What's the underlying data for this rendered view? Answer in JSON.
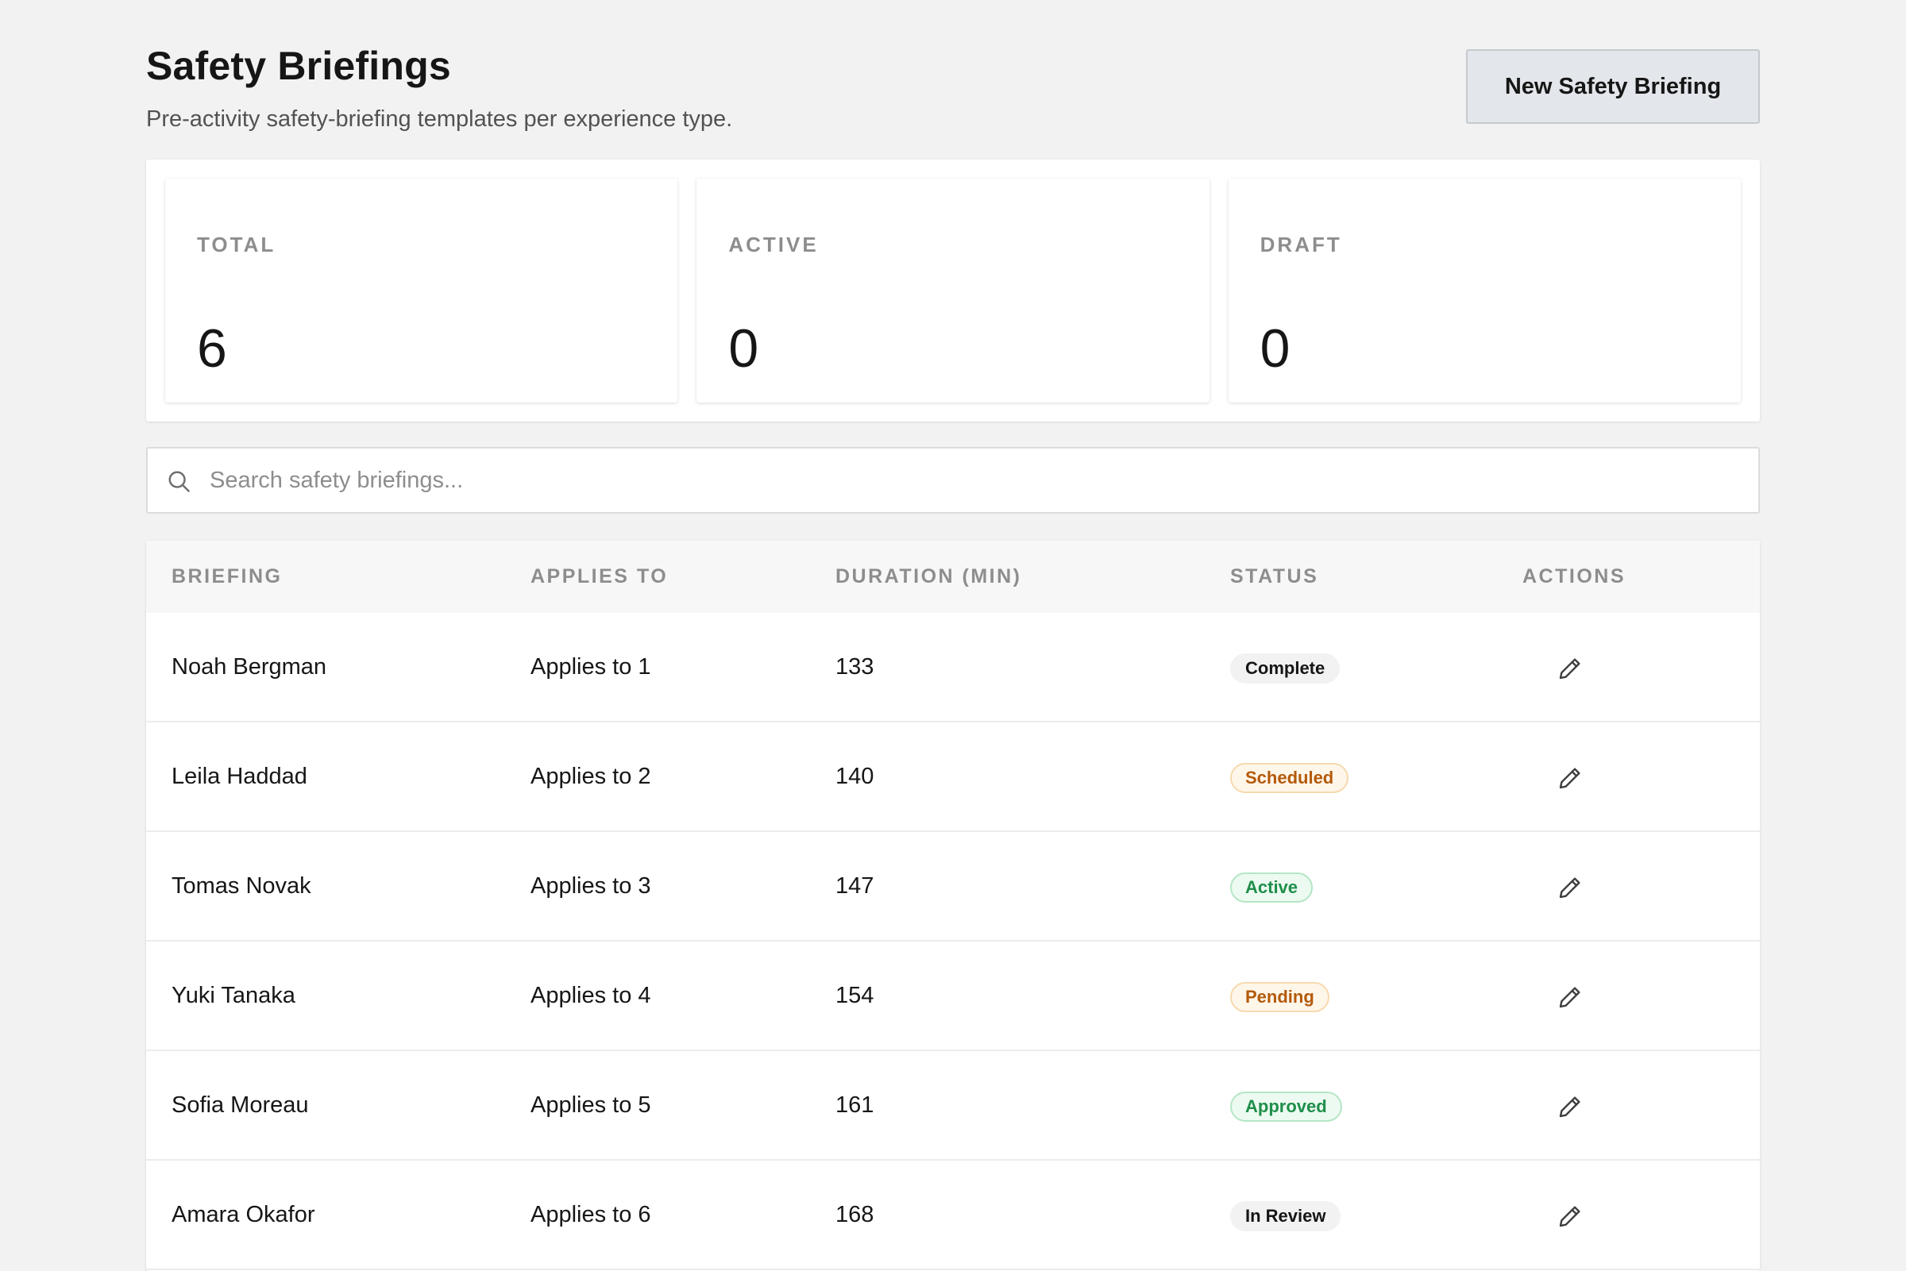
{
  "header": {
    "title": "Safety Briefings",
    "subtitle": "Pre-activity safety-briefing templates per experience type.",
    "new_button_label": "New Safety Briefing"
  },
  "stats": [
    {
      "label": "TOTAL",
      "value": "6"
    },
    {
      "label": "ACTIVE",
      "value": "0"
    },
    {
      "label": "DRAFT",
      "value": "0"
    }
  ],
  "search": {
    "placeholder": "Search safety briefings...",
    "value": ""
  },
  "table": {
    "columns": [
      "BRIEFING",
      "APPLIES TO",
      "DURATION (MIN)",
      "STATUS",
      "ACTIONS"
    ],
    "rows": [
      {
        "briefing": "Noah Bergman",
        "applies_to": "Applies to 1",
        "duration": "133",
        "status": "Complete"
      },
      {
        "briefing": "Leila Haddad",
        "applies_to": "Applies to 2",
        "duration": "140",
        "status": "Scheduled"
      },
      {
        "briefing": "Tomas Novak",
        "applies_to": "Applies to 3",
        "duration": "147",
        "status": "Active"
      },
      {
        "briefing": "Yuki Tanaka",
        "applies_to": "Applies to 4",
        "duration": "154",
        "status": "Pending"
      },
      {
        "briefing": "Sofia Moreau",
        "applies_to": "Applies to 5",
        "duration": "161",
        "status": "Approved"
      },
      {
        "briefing": "Amara Okafor",
        "applies_to": "Applies to 6",
        "duration": "168",
        "status": "In Review"
      }
    ]
  },
  "status_colors": {
    "Complete": {
      "bg": "#f2f2f2",
      "border": "#f2f2f2",
      "text": "#161616"
    },
    "In Review": {
      "bg": "#f2f2f2",
      "border": "#f2f2f2",
      "text": "#161616"
    },
    "Scheduled": {
      "bg": "#fff6ea",
      "border": "#f7d9ad",
      "text": "#b35a0a"
    },
    "Pending": {
      "bg": "#fff6ea",
      "border": "#f7d9ad",
      "text": "#b35a0a"
    },
    "Active": {
      "bg": "#ecfaf1",
      "border": "#b4e6c5",
      "text": "#1e8e4a"
    },
    "Approved": {
      "bg": "#ecfaf1",
      "border": "#b4e6c5",
      "text": "#1e8e4a"
    }
  },
  "icons": {
    "search": "search-icon",
    "edit": "pencil-icon"
  }
}
